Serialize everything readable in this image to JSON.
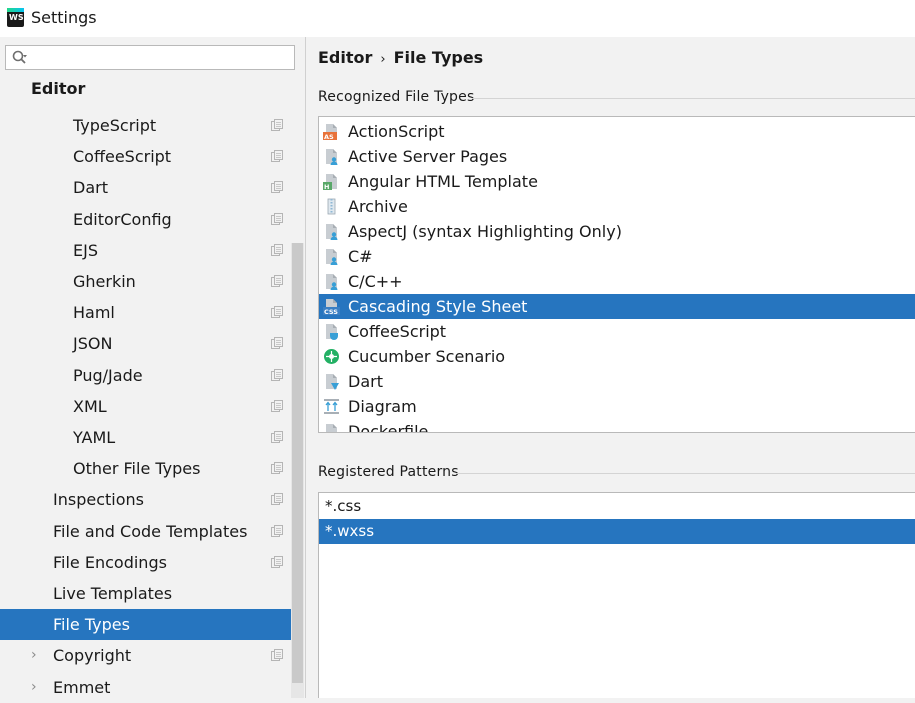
{
  "window": {
    "title": "Settings",
    "logo_text": "WS"
  },
  "search": {
    "placeholder": "",
    "value": ""
  },
  "sidebar": {
    "section": "Editor",
    "items": [
      {
        "label": "TypeScript",
        "level": 2,
        "copy": true
      },
      {
        "label": "CoffeeScript",
        "level": 2,
        "copy": true
      },
      {
        "label": "Dart",
        "level": 2,
        "copy": true
      },
      {
        "label": "EditorConfig",
        "level": 2,
        "copy": true
      },
      {
        "label": "EJS",
        "level": 2,
        "copy": true
      },
      {
        "label": "Gherkin",
        "level": 2,
        "copy": true
      },
      {
        "label": "Haml",
        "level": 2,
        "copy": true
      },
      {
        "label": "JSON",
        "level": 2,
        "copy": true
      },
      {
        "label": "Pug/Jade",
        "level": 2,
        "copy": true
      },
      {
        "label": "XML",
        "level": 2,
        "copy": true
      },
      {
        "label": "YAML",
        "level": 2,
        "copy": true
      },
      {
        "label": "Other File Types",
        "level": 2,
        "copy": true
      },
      {
        "label": "Inspections",
        "level": 1,
        "copy": true
      },
      {
        "label": "File and Code Templates",
        "level": 1,
        "copy": true
      },
      {
        "label": "File Encodings",
        "level": 1,
        "copy": true
      },
      {
        "label": "Live Templates",
        "level": 1,
        "copy": false
      },
      {
        "label": "File Types",
        "level": 1,
        "copy": false,
        "selected": true
      },
      {
        "label": "Copyright",
        "level": 1,
        "copy": true,
        "expandable": true
      },
      {
        "label": "Emmet",
        "level": 1,
        "copy": false,
        "expandable": true
      }
    ]
  },
  "breadcrumb": {
    "parent": "Editor",
    "separator": "›",
    "current": "File Types"
  },
  "recognized": {
    "title": "Recognized File Types",
    "items": [
      {
        "label": "ActionScript",
        "icon": "actionscript-icon",
        "badge": "AS",
        "color": "#e8723a"
      },
      {
        "label": "Active Server Pages",
        "icon": "asp-icon",
        "color": "#389fd6"
      },
      {
        "label": "Angular HTML Template",
        "icon": "angular-html-icon",
        "badge": "H",
        "color": "#59a869"
      },
      {
        "label": "Archive",
        "icon": "archive-icon",
        "color": "#8fb7d4"
      },
      {
        "label": "AspectJ (syntax Highlighting Only)",
        "icon": "aspectj-icon",
        "color": "#389fd6"
      },
      {
        "label": "C#",
        "icon": "csharp-icon",
        "color": "#389fd6"
      },
      {
        "label": "C/C++",
        "icon": "cpp-icon",
        "color": "#389fd6"
      },
      {
        "label": "Cascading Style Sheet",
        "icon": "css-icon",
        "badge": "CSS",
        "color": "#3a7fc4",
        "selected": true
      },
      {
        "label": "CoffeeScript",
        "icon": "coffeescript-icon",
        "color": "#389fd6"
      },
      {
        "label": "Cucumber Scenario",
        "icon": "cucumber-icon",
        "color": "#23b064"
      },
      {
        "label": "Dart",
        "icon": "dart-icon",
        "color": "#389fd6"
      },
      {
        "label": "Diagram",
        "icon": "diagram-icon",
        "color": "#389fd6"
      },
      {
        "label": "Dockerfile",
        "icon": "dockerfile-icon",
        "color": "#389fd6"
      }
    ]
  },
  "patterns": {
    "title": "Registered Patterns",
    "items": [
      {
        "label": "*.css"
      },
      {
        "label": "*.wxss",
        "selected": true
      }
    ]
  },
  "colors": {
    "selection": "#2675bf",
    "panel": "#f2f2f2"
  }
}
